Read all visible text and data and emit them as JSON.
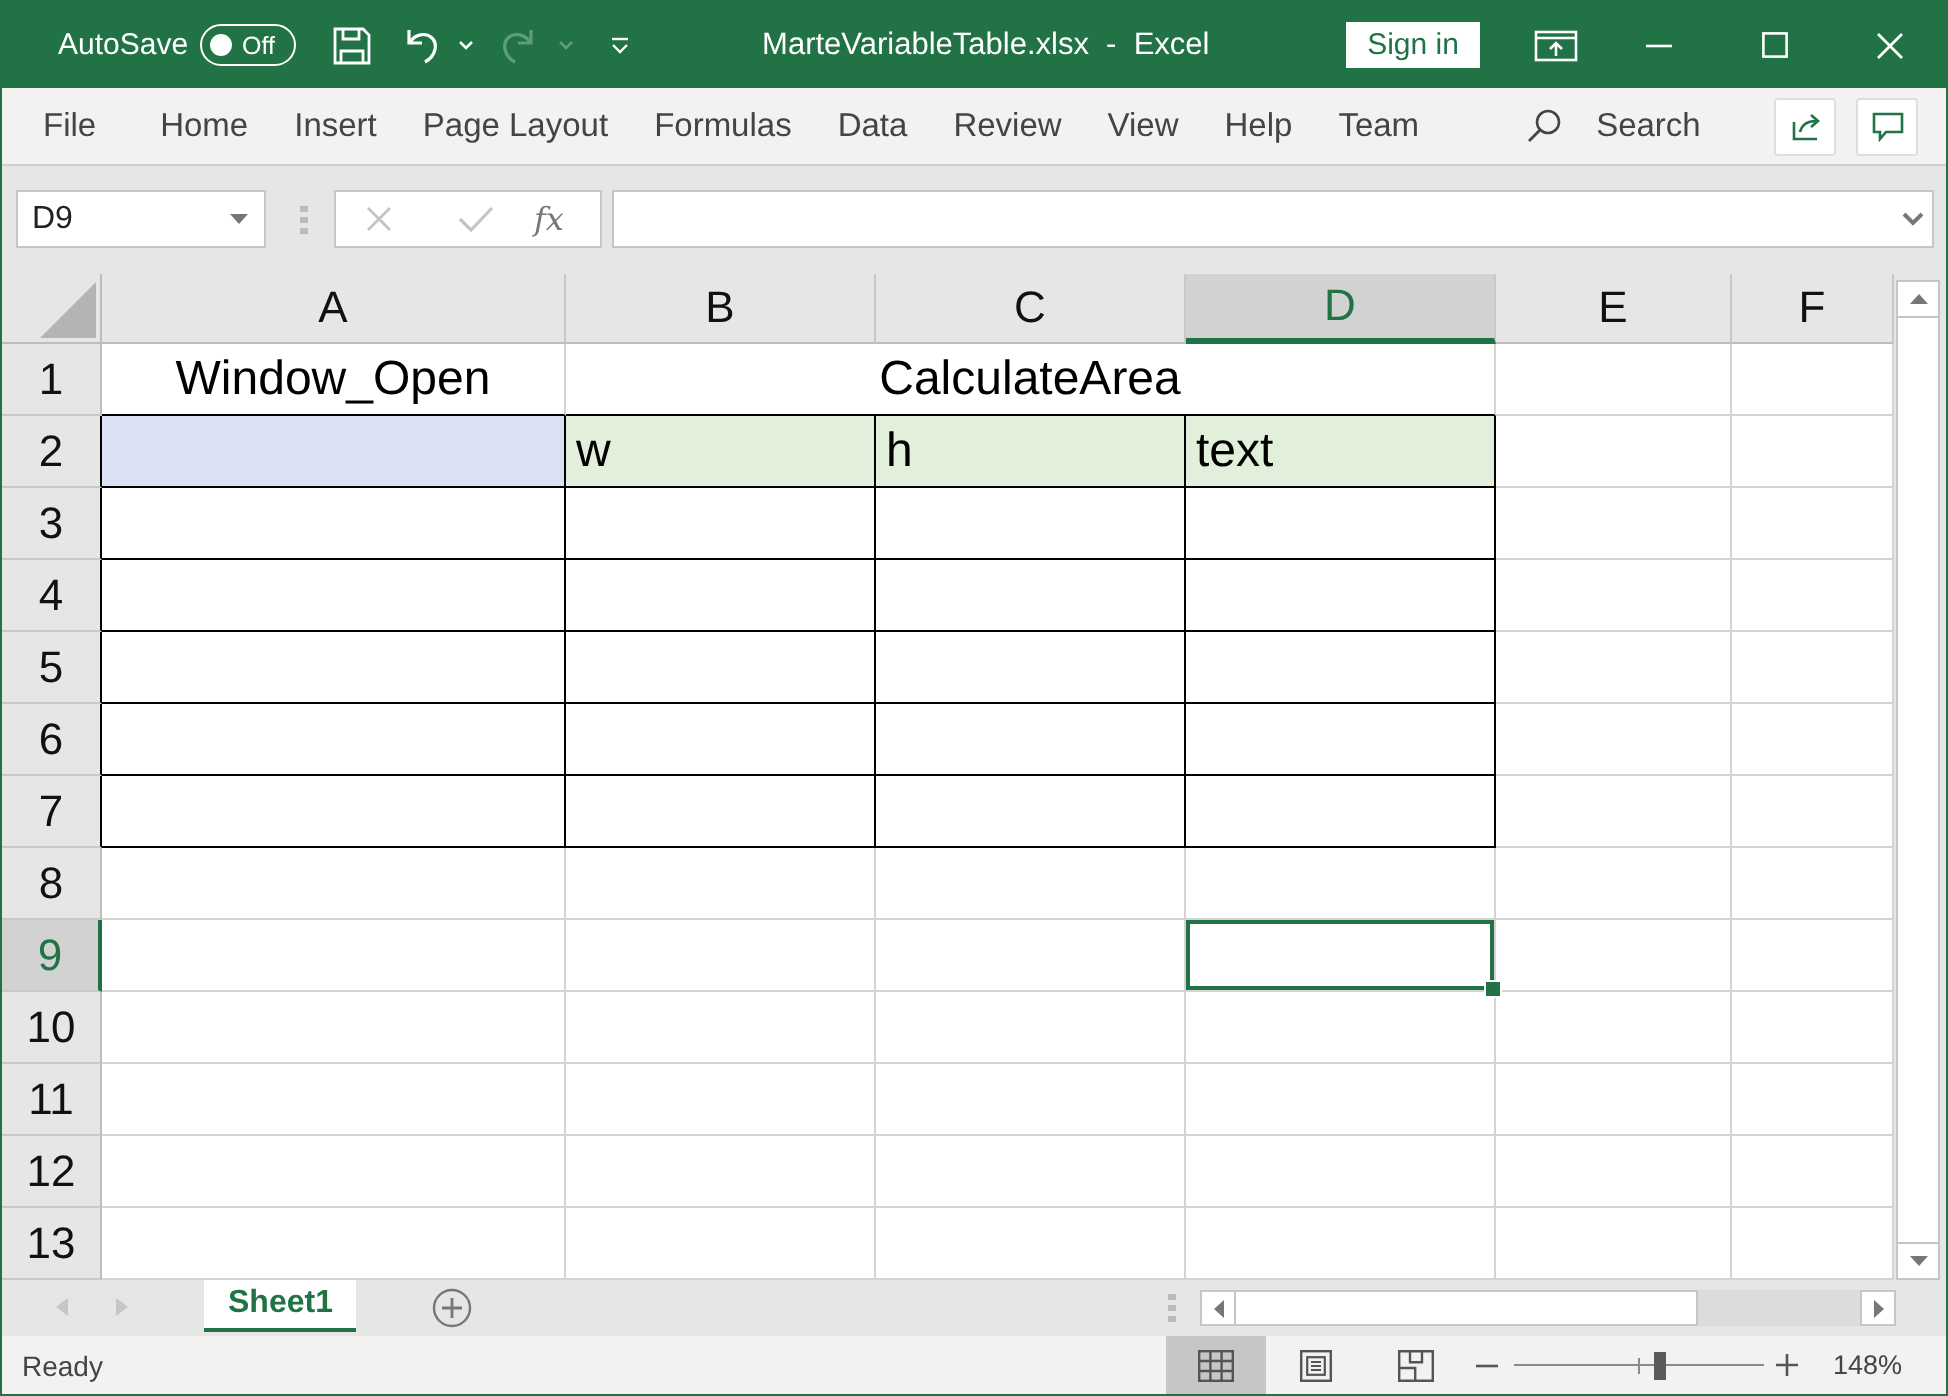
{
  "window": {
    "autosave": {
      "label": "AutoSave",
      "toggle_text": "Off",
      "on": false
    },
    "title": "MarteVariableTable.xlsx  -  Excel",
    "sign_in": "Sign in"
  },
  "ribbon": {
    "tabs": [
      {
        "label": "File"
      },
      {
        "label": "Home"
      },
      {
        "label": "Insert"
      },
      {
        "label": "Page Layout"
      },
      {
        "label": "Formulas"
      },
      {
        "label": "Data"
      },
      {
        "label": "Review"
      },
      {
        "label": "View"
      },
      {
        "label": "Help"
      },
      {
        "label": "Team"
      }
    ],
    "search": "Search"
  },
  "formula_bar": {
    "name_box": "D9",
    "function_label": "fx"
  },
  "sheet": {
    "columns": [
      {
        "label": "A",
        "selected": false
      },
      {
        "label": "B",
        "selected": false
      },
      {
        "label": "C",
        "selected": false
      },
      {
        "label": "D",
        "selected": true
      },
      {
        "label": "E",
        "selected": false
      },
      {
        "label": "F",
        "selected": false
      }
    ],
    "rows": [
      {
        "label": "1",
        "selected": false,
        "cells": [
          {
            "kind": "centered",
            "text": "Window_Open"
          },
          {
            "kind": "merged"
          },
          {
            "kind": "merged",
            "text": "CalculateArea"
          },
          {
            "kind": "merged"
          },
          {
            "kind": "plain"
          },
          {
            "kind": "plain"
          }
        ]
      },
      {
        "label": "2",
        "selected": false,
        "cells": [
          {
            "kind": "bordered",
            "color": "#d9e1f2"
          },
          {
            "kind": "bordered",
            "text": "w",
            "color": "#e2efda"
          },
          {
            "kind": "bordered",
            "text": "h",
            "color": "#e2efda"
          },
          {
            "kind": "bordered",
            "text": "text",
            "color": "#e2efda"
          },
          {
            "kind": "plain"
          },
          {
            "kind": "plain"
          }
        ]
      },
      {
        "label": "3",
        "selected": false,
        "cells": [
          {
            "kind": "bordered"
          },
          {
            "kind": "bordered"
          },
          {
            "kind": "bordered"
          },
          {
            "kind": "bordered"
          },
          {
            "kind": "plain"
          },
          {
            "kind": "plain"
          }
        ]
      },
      {
        "label": "4",
        "selected": false,
        "cells": [
          {
            "kind": "bordered"
          },
          {
            "kind": "bordered"
          },
          {
            "kind": "bordered"
          },
          {
            "kind": "bordered"
          },
          {
            "kind": "plain"
          },
          {
            "kind": "plain"
          }
        ]
      },
      {
        "label": "5",
        "selected": false,
        "cells": [
          {
            "kind": "bordered"
          },
          {
            "kind": "bordered"
          },
          {
            "kind": "bordered"
          },
          {
            "kind": "bordered"
          },
          {
            "kind": "plain"
          },
          {
            "kind": "plain"
          }
        ]
      },
      {
        "label": "6",
        "selected": false,
        "cells": [
          {
            "kind": "bordered"
          },
          {
            "kind": "bordered"
          },
          {
            "kind": "bordered"
          },
          {
            "kind": "bordered"
          },
          {
            "kind": "plain"
          },
          {
            "kind": "plain"
          }
        ]
      },
      {
        "label": "7",
        "selected": false,
        "cells": [
          {
            "kind": "bordered"
          },
          {
            "kind": "bordered"
          },
          {
            "kind": "bordered"
          },
          {
            "kind": "bordered"
          },
          {
            "kind": "plain"
          },
          {
            "kind": "plain"
          }
        ]
      },
      {
        "label": "8",
        "selected": false,
        "cells": [
          {
            "kind": "plain"
          },
          {
            "kind": "plain"
          },
          {
            "kind": "plain"
          },
          {
            "kind": "plain"
          },
          {
            "kind": "plain"
          },
          {
            "kind": "plain"
          }
        ]
      },
      {
        "label": "9",
        "selected": true,
        "cells": [
          {
            "kind": "plain"
          },
          {
            "kind": "plain"
          },
          {
            "kind": "plain"
          },
          {
            "kind": "plain"
          },
          {
            "kind": "plain"
          },
          {
            "kind": "plain"
          }
        ]
      },
      {
        "label": "10",
        "selected": false,
        "cells": [
          {
            "kind": "plain"
          },
          {
            "kind": "plain"
          },
          {
            "kind": "plain"
          },
          {
            "kind": "plain"
          },
          {
            "kind": "plain"
          },
          {
            "kind": "plain"
          }
        ]
      },
      {
        "label": "11",
        "selected": false,
        "cells": [
          {
            "kind": "plain"
          },
          {
            "kind": "plain"
          },
          {
            "kind": "plain"
          },
          {
            "kind": "plain"
          },
          {
            "kind": "plain"
          },
          {
            "kind": "plain"
          }
        ]
      },
      {
        "label": "12",
        "selected": false,
        "cells": [
          {
            "kind": "plain"
          },
          {
            "kind": "plain"
          },
          {
            "kind": "plain"
          },
          {
            "kind": "plain"
          },
          {
            "kind": "plain"
          },
          {
            "kind": "plain"
          }
        ]
      },
      {
        "label": "13",
        "selected": false,
        "cells": [
          {
            "kind": "plain"
          },
          {
            "kind": "plain"
          },
          {
            "kind": "plain"
          },
          {
            "kind": "plain"
          },
          {
            "kind": "plain"
          },
          {
            "kind": "plain"
          }
        ]
      }
    ]
  },
  "sheet_tabs": [
    {
      "label": "Sheet1",
      "selected": true
    }
  ],
  "status_bar": {
    "status": "Ready",
    "views": [
      {
        "kind": "normal",
        "selected": true
      },
      {
        "kind": "page_layout",
        "selected": false
      },
      {
        "kind": "page_break",
        "selected": false
      }
    ],
    "zoom": {
      "level": 0.58,
      "reading": "148%"
    }
  }
}
